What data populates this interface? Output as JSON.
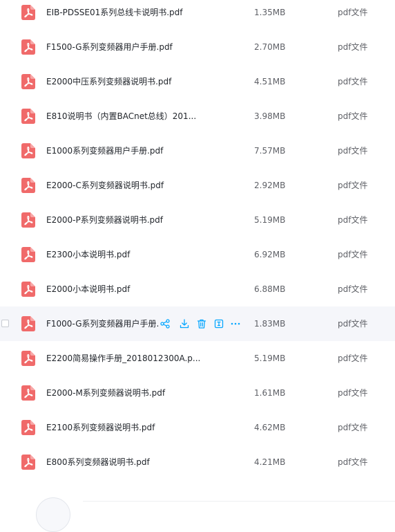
{
  "files": [
    {
      "name": "EIB-PDSSE01系列总线卡说明书.pdf",
      "size": "1.35MB",
      "type": "pdf文件"
    },
    {
      "name": "F1500-G系列变频器用户手册.pdf",
      "size": "2.70MB",
      "type": "pdf文件"
    },
    {
      "name": "E2000中压系列变频器说明书.pdf",
      "size": "4.51MB",
      "type": "pdf文件"
    },
    {
      "name": "E810说明书（内置BACnet总线）201...",
      "size": "3.98MB",
      "type": "pdf文件"
    },
    {
      "name": "E1000系列变频器用户手册.pdf",
      "size": "7.57MB",
      "type": "pdf文件"
    },
    {
      "name": "E2000-C系列变频器说明书.pdf",
      "size": "2.92MB",
      "type": "pdf文件"
    },
    {
      "name": "E2000-P系列变频器说明书.pdf",
      "size": "5.19MB",
      "type": "pdf文件"
    },
    {
      "name": "E2300小本说明书.pdf",
      "size": "6.92MB",
      "type": "pdf文件"
    },
    {
      "name": "E2000小本说明书.pdf",
      "size": "6.88MB",
      "type": "pdf文件"
    },
    {
      "name": "F1000-G系列变频器用户手册.",
      "size": "1.83MB",
      "type": "pdf文件"
    },
    {
      "name": "E2200简易操作手册_2018012300A.p...",
      "size": "5.19MB",
      "type": "pdf文件"
    },
    {
      "name": "E2000-M系列变频器说明书.pdf",
      "size": "1.61MB",
      "type": "pdf文件"
    },
    {
      "name": "E2100系列变频器说明书.pdf",
      "size": "4.62MB",
      "type": "pdf文件"
    },
    {
      "name": "E800系列变频器说明书.pdf",
      "size": "4.21MB",
      "type": "pdf文件"
    }
  ],
  "hovered_row_index": 9,
  "row_actions": [
    {
      "icon": "share-icon"
    },
    {
      "icon": "download-icon"
    },
    {
      "icon": "delete-icon"
    },
    {
      "icon": "rename-icon"
    },
    {
      "icon": "more-icon"
    }
  ],
  "colors": {
    "pdf_icon": "#f06a6a",
    "action_icon": "#06a7ff",
    "hover_row": "#f5f6fa"
  }
}
